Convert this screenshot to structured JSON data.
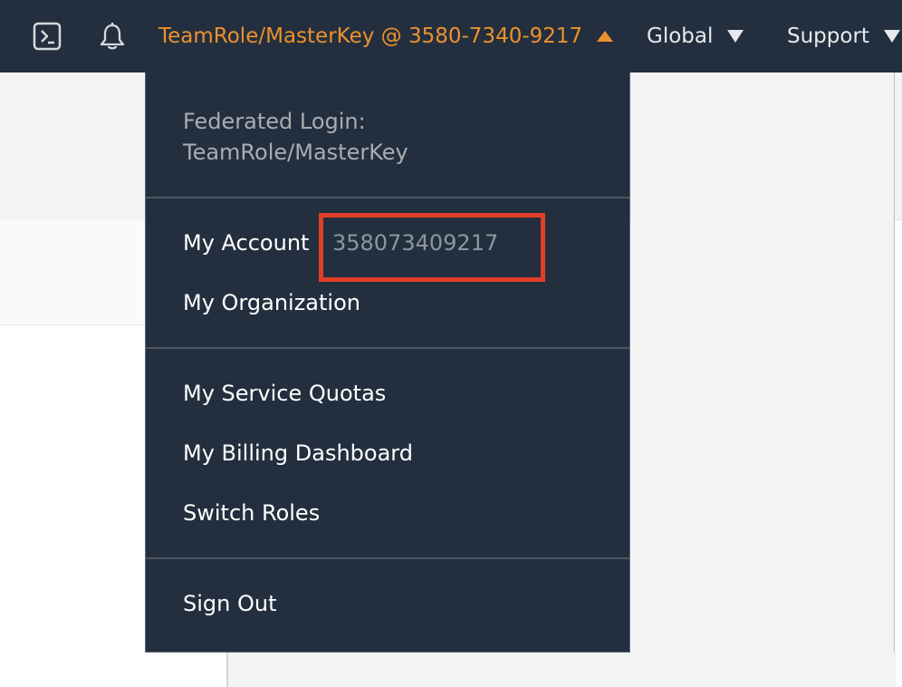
{
  "topbar": {
    "background": "#232f3e",
    "icons": {
      "shell": "cloudshell-icon",
      "notifications": "bell-icon"
    },
    "account_label": "TeamRole/MasterKey @ 3580-7340-9217",
    "account_color": "#ec912d",
    "region_label": "Global",
    "support_label": "Support"
  },
  "dropdown": {
    "federated_label": "Federated Login:",
    "federated_role": "TeamRole/MasterKey",
    "items": [
      {
        "label": "My Account",
        "value": "358073409217"
      },
      {
        "label": "My Organization"
      },
      {
        "label": "My Service Quotas"
      },
      {
        "label": "My Billing Dashboard"
      },
      {
        "label": "Switch Roles"
      },
      {
        "label": "Sign Out"
      }
    ],
    "highlight_color": "#e23d28"
  }
}
